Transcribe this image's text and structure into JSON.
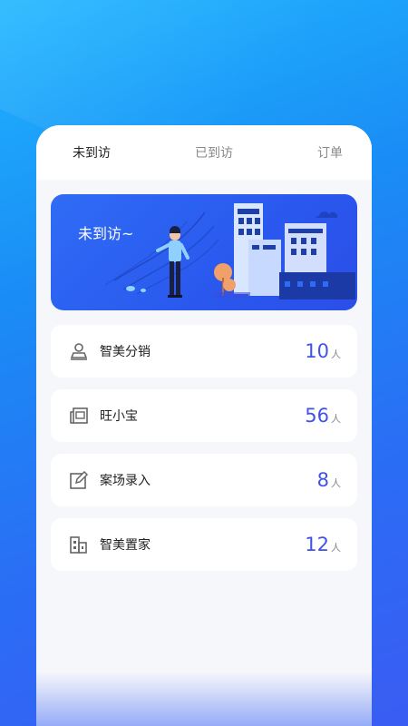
{
  "tabs": [
    {
      "label": "未到访",
      "active": true
    },
    {
      "label": "已到访",
      "active": false
    },
    {
      "label": "订单",
      "active": false
    }
  ],
  "banner": {
    "title": "未到访~"
  },
  "items": [
    {
      "label": "智美分销",
      "count": "10",
      "unit": "人",
      "icon": "user-card-icon"
    },
    {
      "label": "旺小宝",
      "count": "56",
      "unit": "人",
      "icon": "newspaper-icon"
    },
    {
      "label": "案场录入",
      "count": "8",
      "unit": "人",
      "icon": "edit-icon"
    },
    {
      "label": "智美置家",
      "count": "12",
      "unit": "人",
      "icon": "building-icon"
    }
  ],
  "colors": {
    "accent": "#3f52e9",
    "banner": "#2f6cf5"
  }
}
